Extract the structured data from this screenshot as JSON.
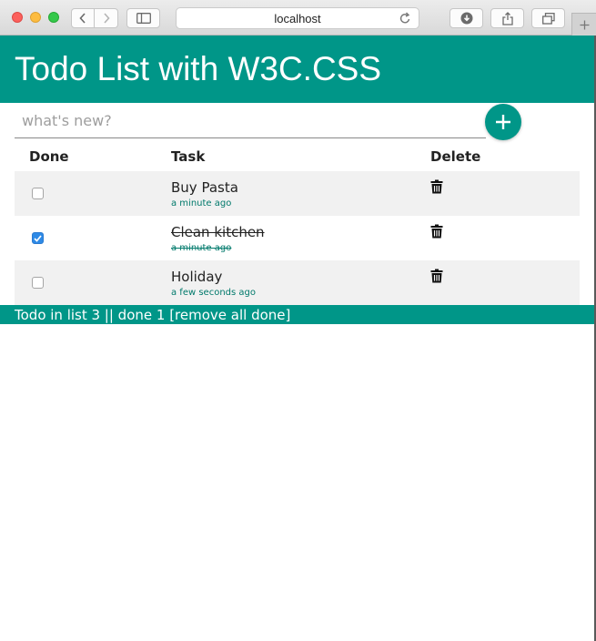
{
  "browser": {
    "url": "localhost"
  },
  "app": {
    "title": "Todo List with W3C.CSS",
    "accent_color": "#009688",
    "new_todo": {
      "placeholder": "what's new?",
      "value": "",
      "add_icon": "plus-icon"
    },
    "columns": {
      "done": "Done",
      "task": "Task",
      "delete": "Delete"
    },
    "todos": [
      {
        "task": "Buy Pasta",
        "ago": "a minute ago",
        "done": false
      },
      {
        "task": "Clean kitchen",
        "ago": "a minute ago",
        "done": true
      },
      {
        "task": "Holiday",
        "ago": "a few seconds ago",
        "done": false
      }
    ],
    "footer": "Todo in list 3 || done 1 [remove all done]"
  }
}
